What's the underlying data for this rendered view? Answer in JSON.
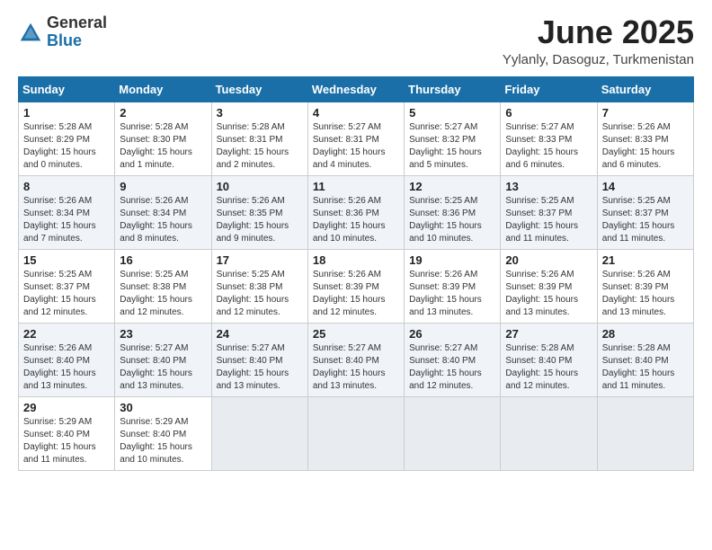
{
  "logo": {
    "general": "General",
    "blue": "Blue"
  },
  "title": {
    "month": "June 2025",
    "location": "Yylanly, Dasoguz, Turkmenistan"
  },
  "weekdays": [
    "Sunday",
    "Monday",
    "Tuesday",
    "Wednesday",
    "Thursday",
    "Friday",
    "Saturday"
  ],
  "weeks": [
    [
      {
        "day": "1",
        "sunrise": "5:28 AM",
        "sunset": "8:29 PM",
        "daylight": "15 hours and 0 minutes."
      },
      {
        "day": "2",
        "sunrise": "5:28 AM",
        "sunset": "8:30 PM",
        "daylight": "15 hours and 1 minute."
      },
      {
        "day": "3",
        "sunrise": "5:28 AM",
        "sunset": "8:31 PM",
        "daylight": "15 hours and 2 minutes."
      },
      {
        "day": "4",
        "sunrise": "5:27 AM",
        "sunset": "8:31 PM",
        "daylight": "15 hours and 4 minutes."
      },
      {
        "day": "5",
        "sunrise": "5:27 AM",
        "sunset": "8:32 PM",
        "daylight": "15 hours and 5 minutes."
      },
      {
        "day": "6",
        "sunrise": "5:27 AM",
        "sunset": "8:33 PM",
        "daylight": "15 hours and 6 minutes."
      },
      {
        "day": "7",
        "sunrise": "5:26 AM",
        "sunset": "8:33 PM",
        "daylight": "15 hours and 6 minutes."
      }
    ],
    [
      {
        "day": "8",
        "sunrise": "5:26 AM",
        "sunset": "8:34 PM",
        "daylight": "15 hours and 7 minutes."
      },
      {
        "day": "9",
        "sunrise": "5:26 AM",
        "sunset": "8:34 PM",
        "daylight": "15 hours and 8 minutes."
      },
      {
        "day": "10",
        "sunrise": "5:26 AM",
        "sunset": "8:35 PM",
        "daylight": "15 hours and 9 minutes."
      },
      {
        "day": "11",
        "sunrise": "5:26 AM",
        "sunset": "8:36 PM",
        "daylight": "15 hours and 10 minutes."
      },
      {
        "day": "12",
        "sunrise": "5:25 AM",
        "sunset": "8:36 PM",
        "daylight": "15 hours and 10 minutes."
      },
      {
        "day": "13",
        "sunrise": "5:25 AM",
        "sunset": "8:37 PM",
        "daylight": "15 hours and 11 minutes."
      },
      {
        "day": "14",
        "sunrise": "5:25 AM",
        "sunset": "8:37 PM",
        "daylight": "15 hours and 11 minutes."
      }
    ],
    [
      {
        "day": "15",
        "sunrise": "5:25 AM",
        "sunset": "8:37 PM",
        "daylight": "15 hours and 12 minutes."
      },
      {
        "day": "16",
        "sunrise": "5:25 AM",
        "sunset": "8:38 PM",
        "daylight": "15 hours and 12 minutes."
      },
      {
        "day": "17",
        "sunrise": "5:25 AM",
        "sunset": "8:38 PM",
        "daylight": "15 hours and 12 minutes."
      },
      {
        "day": "18",
        "sunrise": "5:26 AM",
        "sunset": "8:39 PM",
        "daylight": "15 hours and 12 minutes."
      },
      {
        "day": "19",
        "sunrise": "5:26 AM",
        "sunset": "8:39 PM",
        "daylight": "15 hours and 13 minutes."
      },
      {
        "day": "20",
        "sunrise": "5:26 AM",
        "sunset": "8:39 PM",
        "daylight": "15 hours and 13 minutes."
      },
      {
        "day": "21",
        "sunrise": "5:26 AM",
        "sunset": "8:39 PM",
        "daylight": "15 hours and 13 minutes."
      }
    ],
    [
      {
        "day": "22",
        "sunrise": "5:26 AM",
        "sunset": "8:40 PM",
        "daylight": "15 hours and 13 minutes."
      },
      {
        "day": "23",
        "sunrise": "5:27 AM",
        "sunset": "8:40 PM",
        "daylight": "15 hours and 13 minutes."
      },
      {
        "day": "24",
        "sunrise": "5:27 AM",
        "sunset": "8:40 PM",
        "daylight": "15 hours and 13 minutes."
      },
      {
        "day": "25",
        "sunrise": "5:27 AM",
        "sunset": "8:40 PM",
        "daylight": "15 hours and 13 minutes."
      },
      {
        "day": "26",
        "sunrise": "5:27 AM",
        "sunset": "8:40 PM",
        "daylight": "15 hours and 12 minutes."
      },
      {
        "day": "27",
        "sunrise": "5:28 AM",
        "sunset": "8:40 PM",
        "daylight": "15 hours and 12 minutes."
      },
      {
        "day": "28",
        "sunrise": "5:28 AM",
        "sunset": "8:40 PM",
        "daylight": "15 hours and 11 minutes."
      }
    ],
    [
      {
        "day": "29",
        "sunrise": "5:29 AM",
        "sunset": "8:40 PM",
        "daylight": "15 hours and 11 minutes."
      },
      {
        "day": "30",
        "sunrise": "5:29 AM",
        "sunset": "8:40 PM",
        "daylight": "15 hours and 10 minutes."
      },
      null,
      null,
      null,
      null,
      null
    ]
  ]
}
